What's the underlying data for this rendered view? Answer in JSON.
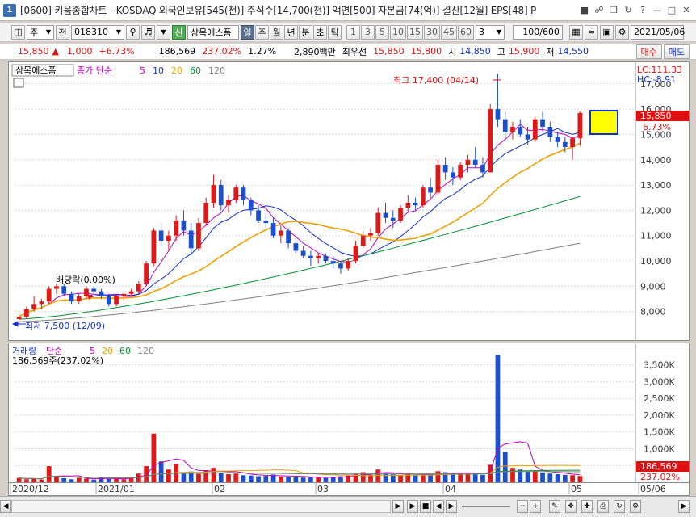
{
  "window": {
    "title": "[0600] 키움종합차트 - KOSDAQ 외국인보유[545(천)] 주식수[14,700(천)] 액면[500] 자본금[74(억)] 결산[12월] EPS[48] P",
    "icon_label": "1"
  },
  "toolbar": {
    "market": "주",
    "prev_label": "전",
    "code": "018310",
    "credit_badge": "신",
    "stock_name": "삼목에스폼",
    "periods": [
      "일",
      "주",
      "월",
      "년",
      "분",
      "초",
      "틱"
    ],
    "active_period": "일",
    "intervals": [
      "1",
      "3",
      "5",
      "10",
      "15",
      "30",
      "45",
      "60"
    ],
    "interval_value": "3",
    "count": "100/600",
    "date": "2021/05/06"
  },
  "quote": {
    "price": "15,850",
    "change": "1,000",
    "change_pct": "+6.73%",
    "volume": "186,569",
    "volume_ratio": "237.02%",
    "turnover": "1.27%",
    "amount": "2,890백만",
    "best_label": "최우선",
    "ask": "15,850",
    "bid": "15,800",
    "open_label": "시",
    "open": "14,850",
    "high_label": "고",
    "high": "15,900",
    "low_label": "저",
    "low": "14,550",
    "buy_label": "매수",
    "sell_label": "매도"
  },
  "price_panel": {
    "stock_label": "삼목에스폼",
    "ma_title": "종가 단순",
    "ma_periods": [
      "5",
      "10",
      "20",
      "60",
      "120"
    ],
    "ma_colors": [
      "#c000c0",
      "#1030d0",
      "#f0a000",
      "#009030",
      "#808080"
    ],
    "lc": "LC:111.33",
    "hc": "HC:-8.91",
    "current_price": "15,850",
    "current_pct": "6.73%",
    "high_annotation": "최고 17,400 (04/14)",
    "low_annotation": "최저 7,500 (12/09)",
    "dividend_annotation": "배당락(0.00%)",
    "y_ticks": [
      "17,000",
      "16,000",
      "15,000",
      "14,000",
      "13,000",
      "12,000",
      "11,000",
      "10,000",
      "9,000",
      "8,000"
    ]
  },
  "volume_panel": {
    "title": "거래량",
    "ma_title": "단순",
    "ma_periods": [
      "5",
      "20",
      "60",
      "120"
    ],
    "ma_colors": [
      "#c000c0",
      "#f0a000",
      "#009030",
      "#808080"
    ],
    "info": "186,569주(237.02%)",
    "current_volume": "186,569",
    "current_pct": "237.02%",
    "y_ticks": [
      "3,500K",
      "3,000K",
      "2,500K",
      "2,000K",
      "1,500K",
      "1,000K",
      "500K"
    ]
  },
  "x_axis": [
    "2020/12",
    "2021/01",
    "02",
    "03",
    "04",
    "05",
    "05/06"
  ],
  "colors": {
    "up": "#e01818",
    "down": "#1a4fd0",
    "accent": "#3a6fb5"
  },
  "chart_data": {
    "type": "candlestick",
    "ylim": [
      7000,
      17600
    ],
    "volume_ylim": [
      0,
      3900000
    ],
    "candles": [
      [
        7700,
        7900,
        7500,
        7800
      ],
      [
        7800,
        8200,
        7700,
        8100
      ],
      [
        8100,
        8600,
        8000,
        8300
      ],
      [
        8300,
        8500,
        8100,
        8400
      ],
      [
        8400,
        9000,
        8300,
        8900
      ],
      [
        8900,
        9100,
        8700,
        9000
      ],
      [
        9000,
        9100,
        8600,
        8700
      ],
      [
        8700,
        8800,
        8300,
        8400
      ],
      [
        8400,
        8700,
        8300,
        8600
      ],
      [
        8600,
        9000,
        8500,
        8900
      ],
      [
        8900,
        9000,
        8700,
        8800
      ],
      [
        8800,
        8900,
        8500,
        8600
      ],
      [
        8600,
        8700,
        8200,
        8300
      ],
      [
        8300,
        8700,
        8200,
        8600
      ],
      [
        8600,
        8800,
        8400,
        8700
      ],
      [
        8700,
        8900,
        8600,
        8800
      ],
      [
        8800,
        9200,
        8700,
        9100
      ],
      [
        9100,
        10000,
        9000,
        9900
      ],
      [
        9900,
        11300,
        9800,
        11200
      ],
      [
        11200,
        11500,
        10600,
        10800
      ],
      [
        10800,
        11200,
        10400,
        11000
      ],
      [
        11000,
        11800,
        10800,
        11600
      ],
      [
        11600,
        12000,
        11000,
        11200
      ],
      [
        11200,
        11500,
        10300,
        10500
      ],
      [
        10500,
        11700,
        10400,
        11500
      ],
      [
        11500,
        12500,
        11400,
        12300
      ],
      [
        12300,
        13400,
        12100,
        13000
      ],
      [
        13000,
        13200,
        12000,
        12200
      ],
      [
        12200,
        12600,
        11900,
        12400
      ],
      [
        12400,
        13000,
        12300,
        12900
      ],
      [
        12900,
        13000,
        12200,
        12400
      ],
      [
        12400,
        12500,
        11800,
        12000
      ],
      [
        12000,
        12200,
        11500,
        11600
      ],
      [
        11600,
        11900,
        11300,
        11500
      ],
      [
        11500,
        11700,
        10900,
        11000
      ],
      [
        11000,
        11400,
        10700,
        11200
      ],
      [
        11200,
        11300,
        10500,
        10700
      ],
      [
        10700,
        10900,
        10300,
        10400
      ],
      [
        10400,
        10600,
        10100,
        10200
      ],
      [
        10200,
        10400,
        9800,
        10100
      ],
      [
        10100,
        10300,
        9900,
        10200
      ],
      [
        10200,
        10300,
        9900,
        10000
      ],
      [
        10000,
        10200,
        9700,
        9900
      ],
      [
        9900,
        10000,
        9500,
        9700
      ],
      [
        9700,
        10100,
        9600,
        10000
      ],
      [
        10000,
        10800,
        9900,
        10600
      ],
      [
        10600,
        11200,
        10500,
        11000
      ],
      [
        11000,
        11300,
        10800,
        11100
      ],
      [
        11100,
        12100,
        11000,
        11900
      ],
      [
        11900,
        12300,
        11500,
        11700
      ],
      [
        11700,
        12000,
        11300,
        11600
      ],
      [
        11600,
        12200,
        11500,
        12100
      ],
      [
        12100,
        12600,
        11900,
        12300
      ],
      [
        12300,
        12500,
        12000,
        12200
      ],
      [
        12200,
        13000,
        12100,
        12900
      ],
      [
        12900,
        13300,
        12500,
        12700
      ],
      [
        12700,
        14000,
        12600,
        13800
      ],
      [
        13800,
        14100,
        13200,
        13500
      ],
      [
        13500,
        13700,
        13000,
        13300
      ],
      [
        13300,
        13900,
        13200,
        13800
      ],
      [
        13800,
        14200,
        13500,
        14000
      ],
      [
        14000,
        14500,
        13700,
        13800
      ],
      [
        13800,
        14100,
        13300,
        13500
      ],
      [
        13500,
        16200,
        13500,
        16000
      ],
      [
        16000,
        17400,
        15300,
        15600
      ],
      [
        15600,
        15900,
        14900,
        15100
      ],
      [
        15100,
        15500,
        14800,
        15300
      ],
      [
        15300,
        15600,
        14900,
        15000
      ],
      [
        15000,
        15300,
        14600,
        14800
      ],
      [
        14800,
        15700,
        14700,
        15600
      ],
      [
        15600,
        15900,
        15100,
        15300
      ],
      [
        15300,
        15500,
        14700,
        14900
      ],
      [
        14900,
        15100,
        14500,
        14700
      ],
      [
        14700,
        14900,
        14300,
        14500
      ],
      [
        14500,
        14900,
        14000,
        14850
      ],
      [
        14850,
        15900,
        14550,
        15850
      ]
    ],
    "volumes": [
      130000,
      90000,
      110000,
      80000,
      480000,
      160000,
      120000,
      90000,
      130000,
      110000,
      80000,
      140000,
      100000,
      120000,
      90000,
      160000,
      260000,
      480000,
      1450000,
      620000,
      380000,
      550000,
      260000,
      320000,
      250000,
      360000,
      430000,
      290000,
      240000,
      260000,
      210000,
      200000,
      180000,
      190000,
      230000,
      170000,
      160000,
      150000,
      140000,
      170000,
      150000,
      130000,
      160000,
      180000,
      200000,
      260000,
      300000,
      220000,
      380000,
      280000,
      230000,
      210000,
      260000,
      220000,
      240000,
      210000,
      330000,
      300000,
      250000,
      280000,
      240000,
      270000,
      220000,
      520000,
      3800000,
      900000,
      430000,
      380000,
      320000,
      350000,
      290000,
      260000,
      240000,
      220000,
      210000,
      186569
    ]
  }
}
